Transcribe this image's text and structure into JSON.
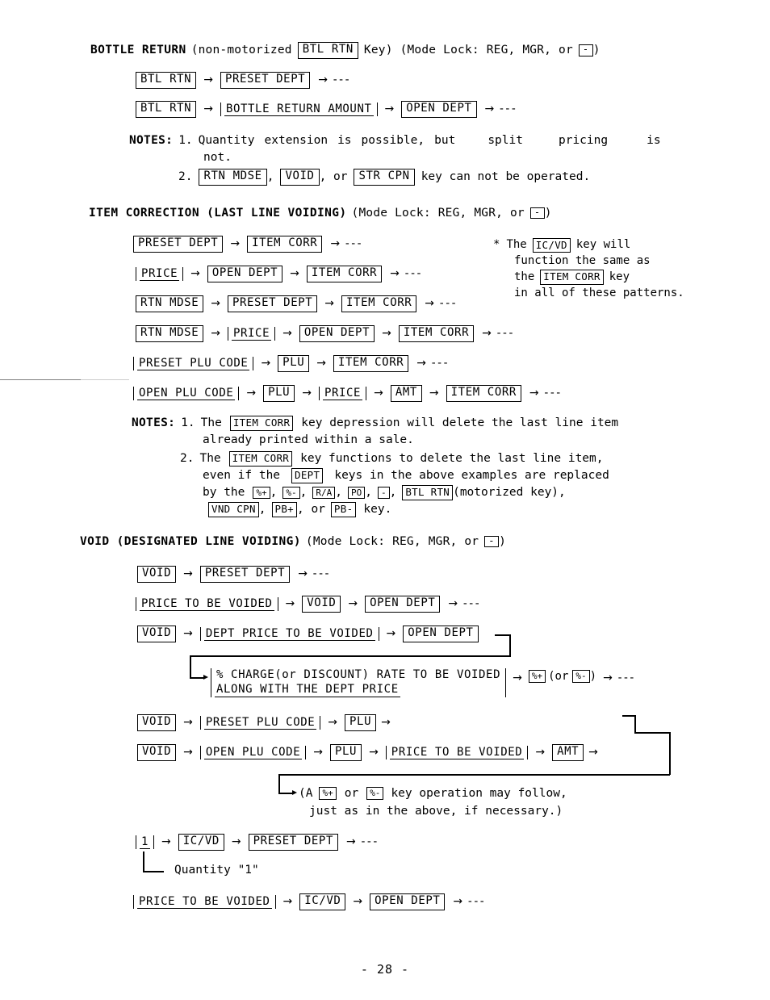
{
  "page": {
    "number_label": "- 28 -"
  },
  "sections": [
    {
      "id": "bottle-return",
      "title": "BOTTLE RETURN",
      "title_tail_pre": "(non-motorized",
      "title_key": "BTL RTN",
      "title_tail_mid": "Key) (Mode Lock: REG, MGR, or",
      "title_mode_key": "-",
      "title_tail_end": ")",
      "flows": [
        {
          "id": "br-flow-1",
          "items": [
            "BTL RTN",
            "PRESET DEPT"
          ],
          "end": "---"
        },
        {
          "id": "br-flow-2",
          "items": [
            "BTL RTN",
            "BOTTLE RETURN AMOUNT",
            "OPEN DEPT"
          ],
          "end": "---"
        }
      ],
      "notes": {
        "label": "NOTES:",
        "items": [
          {
            "num": "1.",
            "line1_words": [
              "Quantity",
              "extension",
              "is",
              "possible,",
              "but",
              "split",
              "pricing",
              "is"
            ],
            "line2": "not."
          },
          {
            "num": "2.",
            "keys": [
              "RTN MDSE",
              "VOID",
              "STR CPN"
            ],
            "text_or": ", or",
            "text_end": "key can not be operated."
          }
        ]
      }
    },
    {
      "id": "item-correction",
      "title": "ITEM CORRECTION (LAST LINE VOIDING)",
      "title_tail_mid": "(Mode Lock: REG, MGR, or",
      "title_mode_key": "-",
      "title_tail_end": ")",
      "flows": [
        {
          "id": "ic-flow-1",
          "items": [
            "PRESET DEPT",
            "ITEM CORR"
          ],
          "end": "---"
        },
        {
          "id": "ic-flow-2",
          "items": [
            "PRICE",
            "OPEN DEPT",
            "ITEM CORR"
          ],
          "end": "---"
        },
        {
          "id": "ic-flow-3",
          "items": [
            "RTN MDSE",
            "PRESET DEPT",
            "ITEM CORR"
          ],
          "end": "---"
        },
        {
          "id": "ic-flow-4",
          "items": [
            "RTN MDSE",
            "PRICE",
            "OPEN DEPT",
            "ITEM CORR"
          ],
          "end": "---"
        },
        {
          "id": "ic-flow-5",
          "items": [
            "PRESET PLU CODE",
            "PLU",
            "ITEM CORR"
          ],
          "end": "---"
        },
        {
          "id": "ic-flow-6",
          "items": [
            "OPEN PLU CODE",
            "PLU",
            "PRICE",
            "AMT",
            "ITEM CORR"
          ],
          "end": "---"
        }
      ],
      "sidenote": {
        "marker": "*",
        "l1_a": "The",
        "l1_key": "IC/VD",
        "l1_b": "key will",
        "l2": "function the same as",
        "l3_a": "the",
        "l3_key": "ITEM CORR",
        "l3_b": "key",
        "l4": "in all of these patterns."
      },
      "notes": {
        "label": "NOTES:",
        "items": [
          {
            "num": "1.",
            "l1_a": "The",
            "l1_key": "ITEM CORR",
            "l1_b": "key depression will delete the last line item",
            "l2": "already printed within a sale."
          },
          {
            "num": "2.",
            "l1_a": "The",
            "l1_key": "ITEM CORR",
            "l1_b": "key functions to delete the last line item,",
            "l2_a": "even if the",
            "l2_key": "DEPT",
            "l2_b": "keys in the above examples are replaced",
            "l3_a": "by the",
            "l3_keys": [
              "%+",
              "%-",
              "R/A",
              "PO",
              "-",
              "BTL RTN"
            ],
            "l3_tail": "(motorized key),",
            "l4_keys": [
              "VND CPN",
              "PB+",
              "PB-"
            ],
            "l4_or": ", or",
            "l4_tail": "key."
          }
        ]
      }
    },
    {
      "id": "void",
      "title": "VOID (DESIGNATED LINE VOIDING)",
      "title_tail_mid": "(Mode Lock: REG, MGR, or",
      "title_mode_key": "-",
      "title_tail_end": ")",
      "flows": [
        {
          "id": "v-flow-1",
          "items": [
            "VOID",
            "PRESET DEPT"
          ],
          "end": "---"
        },
        {
          "id": "v-flow-2",
          "items": [
            "PRICE TO BE VOIDED",
            "VOID",
            "OPEN DEPT"
          ],
          "end": "---"
        },
        {
          "id": "v-flow-3",
          "items": [
            "VOID",
            "DEPT PRICE TO BE VOIDED",
            "OPEN DEPT"
          ],
          "end": ""
        },
        {
          "id": "v-flow-4",
          "entry_line1": "% CHARGE(or DISCOUNT) RATE TO BE VOIDED",
          "entry_line2": "ALONG WITH THE DEPT PRICE",
          "key_a": "%+",
          "or_open": "(or",
          "key_b": "%-",
          "or_close": ")",
          "end": "---"
        },
        {
          "id": "v-flow-5",
          "items": [
            "VOID",
            "PRESET PLU CODE",
            "PLU"
          ],
          "end": ""
        },
        {
          "id": "v-flow-6",
          "items": [
            "VOID",
            "OPEN PLU CODE",
            "PLU",
            "PRICE TO BE VOIDED",
            "AMT"
          ],
          "end": ""
        },
        {
          "id": "v-flow-7",
          "l1_a": "(A",
          "l1_key1": "%+",
          "l1_or": "or",
          "l1_key2": "%-",
          "l1_b": "key operation may follow,",
          "l2": "just as in the above, if necessary.)"
        },
        {
          "id": "v-flow-8",
          "items": [
            "1",
            "IC/VD",
            "PRESET DEPT"
          ],
          "end": "---"
        },
        {
          "id": "v-flow-9",
          "caption": "Quantity \"1\""
        },
        {
          "id": "v-flow-10",
          "items": [
            "PRICE TO BE VOIDED",
            "IC/VD",
            "OPEN DEPT"
          ],
          "end": "---"
        }
      ]
    }
  ],
  "glyphs": {
    "arrow_right": "→",
    "dashes": "---"
  }
}
